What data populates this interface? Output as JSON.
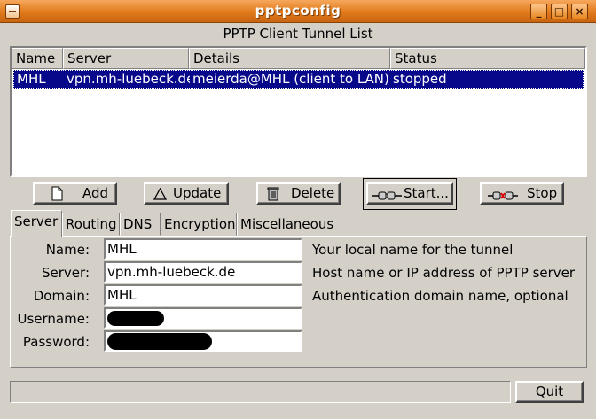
{
  "window": {
    "title": "pptpconfig",
    "controls": [
      "minimize",
      "maximize",
      "close"
    ],
    "title_color": "#e07a1a",
    "selection_color": "#08088a"
  },
  "list": {
    "title": "PPTP Client Tunnel List",
    "columns": [
      "Name",
      "Server",
      "Details",
      "Status"
    ],
    "rows": [
      {
        "name": "MHL",
        "server": "vpn.mh-luebeck.de",
        "details": "meierda@MHL (client to LAN)",
        "status": "stopped",
        "selected": true
      }
    ]
  },
  "actions": {
    "add": "Add",
    "update": "Update",
    "delete": "Delete",
    "start": "Start...",
    "stop": "Stop"
  },
  "tabs": [
    "Server",
    "Routing",
    "DNS",
    "Encryption",
    "Miscellaneous"
  ],
  "active_tab": "Server",
  "form": {
    "name_label": "Name:",
    "name_value": "MHL",
    "name_hint": "Your local name for the tunnel",
    "server_label": "Server:",
    "server_value": "vpn.mh-luebeck.de",
    "server_hint": "Host name or IP address of PPTP server",
    "domain_label": "Domain:",
    "domain_value": "MHL",
    "domain_hint": "Authentication domain name, optional",
    "username_label": "Username:",
    "password_label": "Password:"
  },
  "footer": {
    "status_text": "",
    "quit": "Quit"
  }
}
